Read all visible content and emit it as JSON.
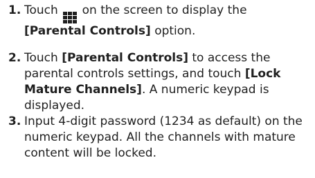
{
  "steps": [
    {
      "number": "1.",
      "part1": "Touch",
      "icon": "grid-menu-icon",
      "part2": "on the screen to display the",
      "bold1": "[Parental Controls]",
      "part3": "option."
    },
    {
      "number": "2.",
      "part1": "Touch",
      "bold1": "[Parental Controls]",
      "part2": "to access the parental controls settings, and touch",
      "bold2": "[Lock Mature Channels]",
      "part3": ". A numeric keypad is displayed."
    },
    {
      "number": "3.",
      "text": "Input 4-digit password (1234 as default) on the numeric keypad. All the channels with mature content will be locked."
    }
  ]
}
